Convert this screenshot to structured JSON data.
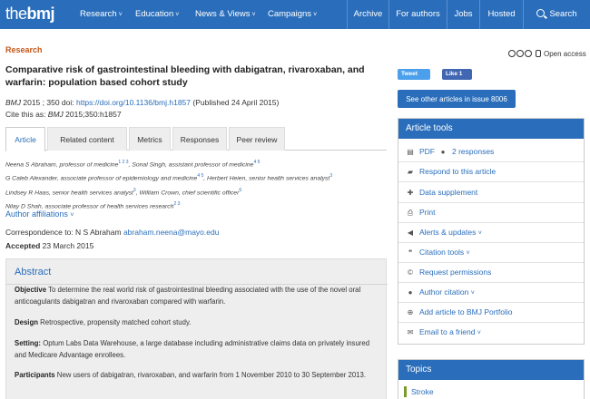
{
  "nav": {
    "logo_the": "the",
    "logo_bmj": "bmj",
    "items": [
      "Research",
      "Education",
      "News & Views",
      "Campaigns"
    ],
    "right_items": [
      "Archive",
      "For authors",
      "Jobs",
      "Hosted"
    ],
    "search": "Search",
    "color": "#2a6ebb"
  },
  "article": {
    "section": "Research",
    "title": "Comparative risk of gastrointestinal bleeding with dabigatran, rivaroxaban, and warfarin: population based cohort study",
    "journal": "BMJ",
    "citation_ref": "2015 ; 350  doi: ",
    "doi": "https://doi.org/10.1136/bmj.h1857",
    "published": " (Published 24 April 2015)",
    "cite_prefix": "Cite this as: ",
    "cite_journal": "BMJ",
    "cite_ref": " 2015;350:h1857"
  },
  "tabs": [
    "Article",
    "Related content",
    "Metrics",
    "Responses",
    "Peer review"
  ],
  "authors": {
    "line1": "Neena S Abraham, professor of medicine",
    "line1_sup": "1 2 3",
    "line1b": ",  Sonal Singh, assistant professor of medicine",
    "line1b_sup": "4 5",
    "line2": "G Caleb Alexander, associate professor of epidemiology and medicine",
    "line2_sup": "4 5",
    "line2b": ",  Herbert Heien, senior health services analyst",
    "line2b_sup": "3",
    "line3": "Lindsey R Haas, senior health services analyst",
    "line3_sup": "3",
    "line3b": ",  William Crown, chief scientific officer",
    "line3b_sup": "6",
    "line4": "Nilay D Shah, associate professor of health services research",
    "line4_sup": "2 3"
  },
  "author_affiliations": "Author affiliations",
  "correspondence_label": "Correspondence to: N S Abraham ",
  "correspondence_email": "abraham.neena@mayo.edu",
  "accepted_label": "Accepted",
  "accepted_date": " 23 March 2015",
  "abstract": {
    "heading": "Abstract",
    "objective_label": "Objective",
    "objective": " To determine the real world risk of gastrointestinal bleeding associated with the use of the novel oral anticoagulants dabigatran and rivaroxaban compared with warfarin.",
    "design_label": "Design",
    "design": " Retrospective, propensity matched cohort study.",
    "setting_label": "Setting:",
    "setting": " Optum Labs Data Warehouse, a large database including administrative claims data on privately insured and Medicare Advantage enrollees.",
    "participants_label": "Participants",
    "participants": " New users of dabigatran, rivaroxaban, and warfarin from 1 November 2010 to 30 September 2013."
  },
  "sidebar": {
    "open_access": "Open access",
    "tweet": "Tweet",
    "like": "Like 1",
    "issue_button": "See other articles in issue 8006",
    "tools_heading": "Article tools",
    "tools": {
      "pdf": "PDF",
      "responses": "2 responses",
      "respond": "Respond to this article",
      "supplement": "Data supplement",
      "print": "Print",
      "alerts": "Alerts & updates",
      "citation": "Citation tools",
      "permissions": "Request permissions",
      "author_citation": "Author citation",
      "portfolio": "Add article to BMJ Portfolio",
      "email": "Email to a friend"
    },
    "topics_heading": "Topics",
    "topic1": "Stroke"
  }
}
